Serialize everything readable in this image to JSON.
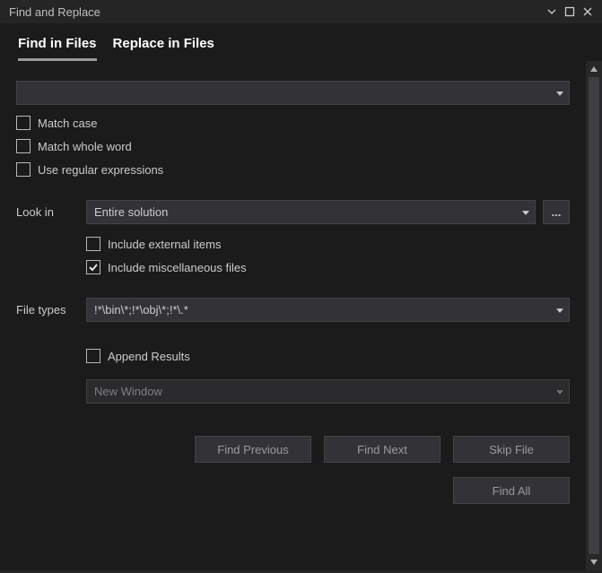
{
  "title": "Find and Replace",
  "tabs": {
    "find": "Find in Files",
    "replace": "Replace in Files"
  },
  "search": {
    "value": ""
  },
  "options": {
    "match_case": "Match case",
    "match_whole_word": "Match whole word",
    "use_regex": "Use regular expressions"
  },
  "look_in": {
    "label": "Look in",
    "value": "Entire solution",
    "include_external": "Include external items",
    "include_misc": "Include miscellaneous files"
  },
  "file_types": {
    "label": "File types",
    "value": "!*\\bin\\*;!*\\obj\\*;!*\\.*"
  },
  "results": {
    "append": "Append Results",
    "window": "New Window"
  },
  "buttons": {
    "find_previous": "Find Previous",
    "find_next": "Find Next",
    "skip_file": "Skip File",
    "find_all": "Find All"
  }
}
